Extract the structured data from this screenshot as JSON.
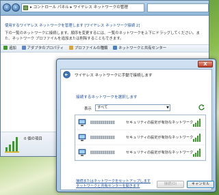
{
  "background_window": {
    "address": "▸ コントロール パネル ▸ ワイヤレス ネットワークの管理",
    "heading_prefix": "使用するワイヤレス ネットワークを管理します",
    "heading_link": "[ワイヤレス ネットワーク接続 2]",
    "description": "下の一覧のネットワークに接続します。順序を変更するには、一覧のネットワークを上下にドラッグしてください。また、ネットワーク プロファイルを追加または削除することもできます。",
    "toolbar": {
      "add": "追加",
      "adapter": "アダプタのプロパティ",
      "profile": "プロファイルの種類",
      "center": "ネットワークと共有センター"
    },
    "status_count": "0 個の項目"
  },
  "dialog": {
    "title": "ワイヤレス ネットワークに手動で接続します",
    "close": "X",
    "subtitle": "接続するネットワークを選択します",
    "show_label": "表示",
    "show_value": "すべて",
    "networks": [
      {
        "security": "セキュリティの設定が有効なネットワーク"
      },
      {
        "security": "セキュリティの設定が有効なネットワーク"
      },
      {
        "security": "セキュリティの設定が有効なネットワーク"
      }
    ],
    "link_setup": "接続またはネットワークをセットアップします",
    "link_center": "ネットワークと共有センターを開きます",
    "connect_button": "接続(O)",
    "cancel_button": "キャンセル"
  },
  "colors": {
    "link": "#1b4fa0",
    "signal": "#3a9a2a"
  }
}
